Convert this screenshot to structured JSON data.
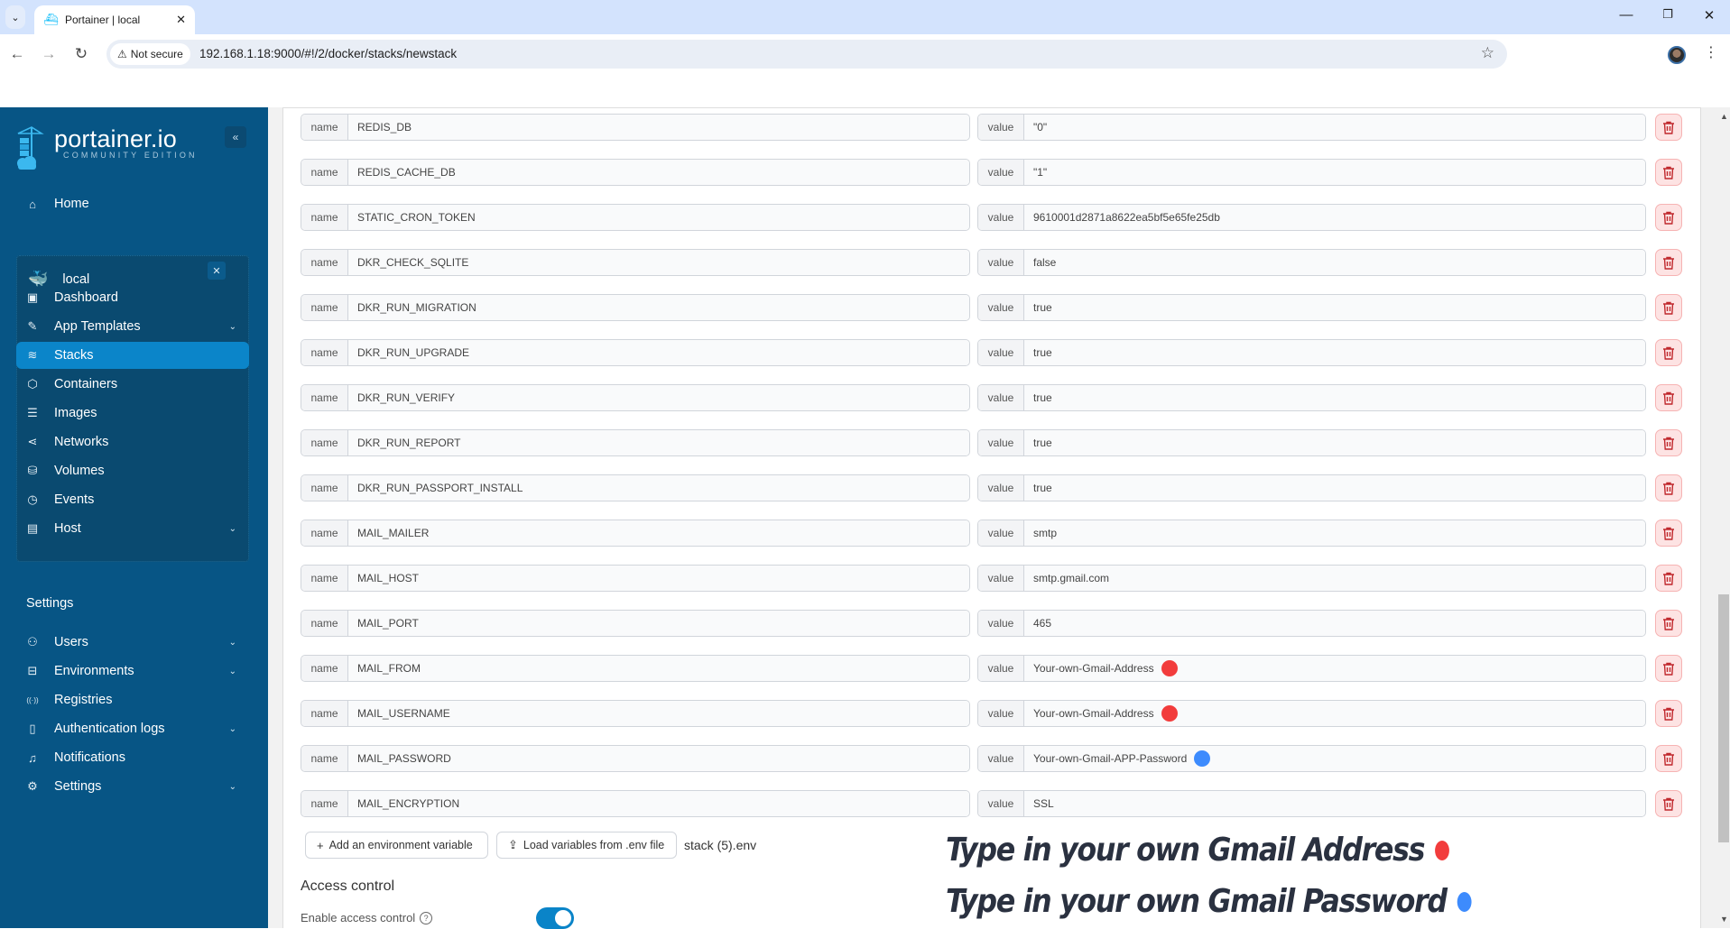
{
  "browser": {
    "tab_title": "Portainer | local",
    "security_label": "Not secure",
    "url": "192.168.1.18:9000/#!/2/docker/stacks/newstack"
  },
  "sidebar": {
    "logo_main": "portainer.io",
    "logo_sub": "COMMUNITY EDITION",
    "collapse_icon": "«",
    "home": {
      "label": "Home",
      "icon": "home-icon"
    },
    "environment": {
      "name": "local",
      "icon": "docker-icon"
    },
    "env_items": [
      {
        "label": "Dashboard",
        "icon": "dashboard-icon",
        "glyph": "▣",
        "chevron": false,
        "active": false
      },
      {
        "label": "App Templates",
        "icon": "edit-icon",
        "glyph": "✎",
        "chevron": true,
        "active": false
      },
      {
        "label": "Stacks",
        "icon": "layers-icon",
        "glyph": "≋",
        "chevron": false,
        "active": true
      },
      {
        "label": "Containers",
        "icon": "box-icon",
        "glyph": "⬡",
        "chevron": false,
        "active": false
      },
      {
        "label": "Images",
        "icon": "list-icon",
        "glyph": "☰",
        "chevron": false,
        "active": false
      },
      {
        "label": "Networks",
        "icon": "share-icon",
        "glyph": "⋖",
        "chevron": false,
        "active": false
      },
      {
        "label": "Volumes",
        "icon": "database-icon",
        "glyph": "⛁",
        "chevron": false,
        "active": false
      },
      {
        "label": "Events",
        "icon": "clock-icon",
        "glyph": "◷",
        "chevron": false,
        "active": false
      },
      {
        "label": "Host",
        "icon": "host-icon",
        "glyph": "▤",
        "chevron": true,
        "active": false
      }
    ],
    "settings_heading": "Settings",
    "settings_items": [
      {
        "label": "Users",
        "icon": "users-icon",
        "glyph": "⚇",
        "chevron": true
      },
      {
        "label": "Environments",
        "icon": "hard-drive-icon",
        "glyph": "⊟",
        "chevron": true
      },
      {
        "label": "Registries",
        "icon": "radio-icon",
        "glyph": "((·))",
        "chevron": false
      },
      {
        "label": "Authentication logs",
        "icon": "file-text-icon",
        "glyph": "▯",
        "chevron": true
      },
      {
        "label": "Notifications",
        "icon": "bell-icon",
        "glyph": "♫",
        "chevron": false
      },
      {
        "label": "Settings",
        "icon": "gear-icon",
        "glyph": "⚙",
        "chevron": true
      }
    ]
  },
  "env_vars": {
    "name_label": "name",
    "value_label": "value",
    "rows": [
      {
        "name": "REDIS_DB",
        "value": "\"0\"",
        "marker": null
      },
      {
        "name": "REDIS_CACHE_DB",
        "value": "\"1\"",
        "marker": null
      },
      {
        "name": "STATIC_CRON_TOKEN",
        "value": "9610001d2871a8622ea5bf5e65fe25db",
        "marker": null
      },
      {
        "name": "DKR_CHECK_SQLITE",
        "value": "false",
        "marker": null
      },
      {
        "name": "DKR_RUN_MIGRATION",
        "value": "true",
        "marker": null
      },
      {
        "name": "DKR_RUN_UPGRADE",
        "value": "true",
        "marker": null
      },
      {
        "name": "DKR_RUN_VERIFY",
        "value": "true",
        "marker": null
      },
      {
        "name": "DKR_RUN_REPORT",
        "value": "true",
        "marker": null
      },
      {
        "name": "DKR_RUN_PASSPORT_INSTALL",
        "value": "true",
        "marker": null
      },
      {
        "name": "MAIL_MAILER",
        "value": "smtp",
        "marker": null
      },
      {
        "name": "MAIL_HOST",
        "value": "smtp.gmail.com",
        "marker": null
      },
      {
        "name": "MAIL_PORT",
        "value": "465",
        "marker": null
      },
      {
        "name": "MAIL_FROM",
        "value": "Your-own-Gmail-Address",
        "marker": "red"
      },
      {
        "name": "MAIL_USERNAME",
        "value": "Your-own-Gmail-Address",
        "marker": "red"
      },
      {
        "name": "MAIL_PASSWORD",
        "value": "Your-own-Gmail-APP-Password",
        "marker": "blue"
      },
      {
        "name": "MAIL_ENCRYPTION",
        "value": "SSL",
        "marker": null
      }
    ],
    "add_button": "Add an environment variable",
    "load_button": "Load variables from .env file",
    "loaded_file": "stack (5).env"
  },
  "access_control": {
    "title": "Access control",
    "enable_label": "Enable access control",
    "enabled": true
  },
  "annotations": [
    {
      "text": "Type in your own Gmail Address",
      "marker": "red"
    },
    {
      "text": "Type in your own Gmail Password",
      "marker": "blue"
    }
  ],
  "colors": {
    "sidebar_bg": "#075585",
    "active_item": "#0b85c9",
    "marker_red": "#f23c3c",
    "marker_blue": "#3d8bfd",
    "delete_icon": "#c0282d",
    "toggle_on": "#0a84c8"
  }
}
